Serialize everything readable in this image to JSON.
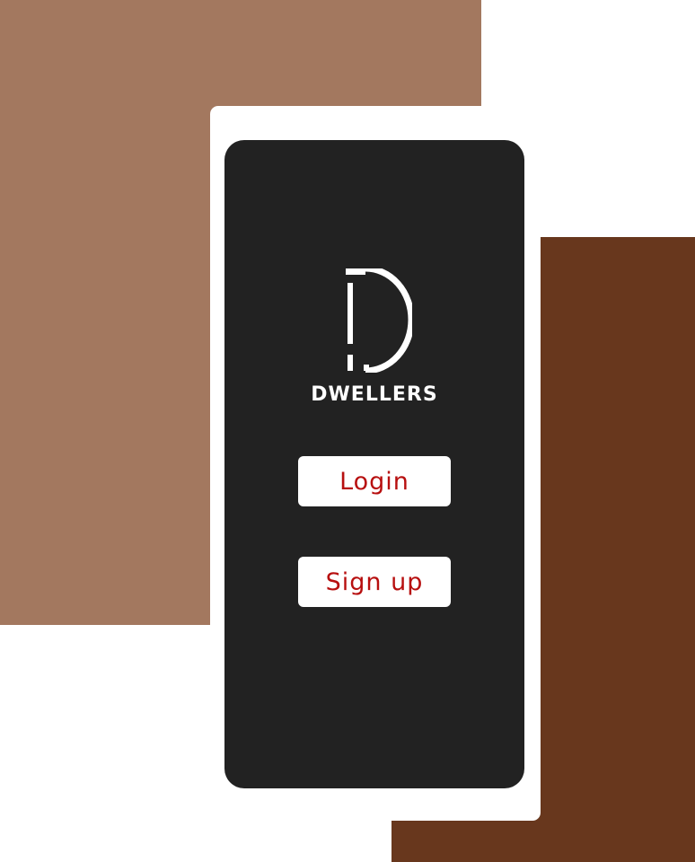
{
  "app": {
    "brand_name": "DWELLERS",
    "logo_icon": "dwellers-d-logo-icon"
  },
  "actions": {
    "login_label": "Login",
    "signup_label": "Sign up"
  },
  "colors": {
    "background_left": "#a3785f",
    "background_right": "#68371d",
    "screen": "#222222",
    "button_background": "#ffffff",
    "button_text": "#b70f0f",
    "brand_text": "#ffffff"
  }
}
